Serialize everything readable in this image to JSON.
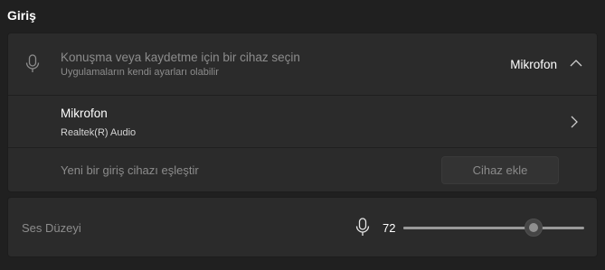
{
  "section": {
    "title": "Giriş"
  },
  "input_device": {
    "title": "Konuşma veya kaydetme için bir cihaz seçin",
    "subtitle": "Uygulamaların kendi ayarları olabilir",
    "selected": "Mikrofon",
    "icon": "microphone-icon",
    "expand_icon": "chevron-up-icon"
  },
  "device": {
    "name": "Mikrofon",
    "description": "Realtek(R) Audio",
    "nav_icon": "chevron-right-icon"
  },
  "pair": {
    "label": "Yeni bir giriş cihazı eşleştir",
    "button_label": "Cihaz ekle"
  },
  "volume": {
    "label": "Ses Düzeyi",
    "value": "72",
    "level": 0.72,
    "icon": "microphone-icon"
  },
  "colors": {
    "background": "#202020",
    "card": "#2b2b2b",
    "text_primary": "#ffffff",
    "text_secondary": "#8c8c8c"
  }
}
